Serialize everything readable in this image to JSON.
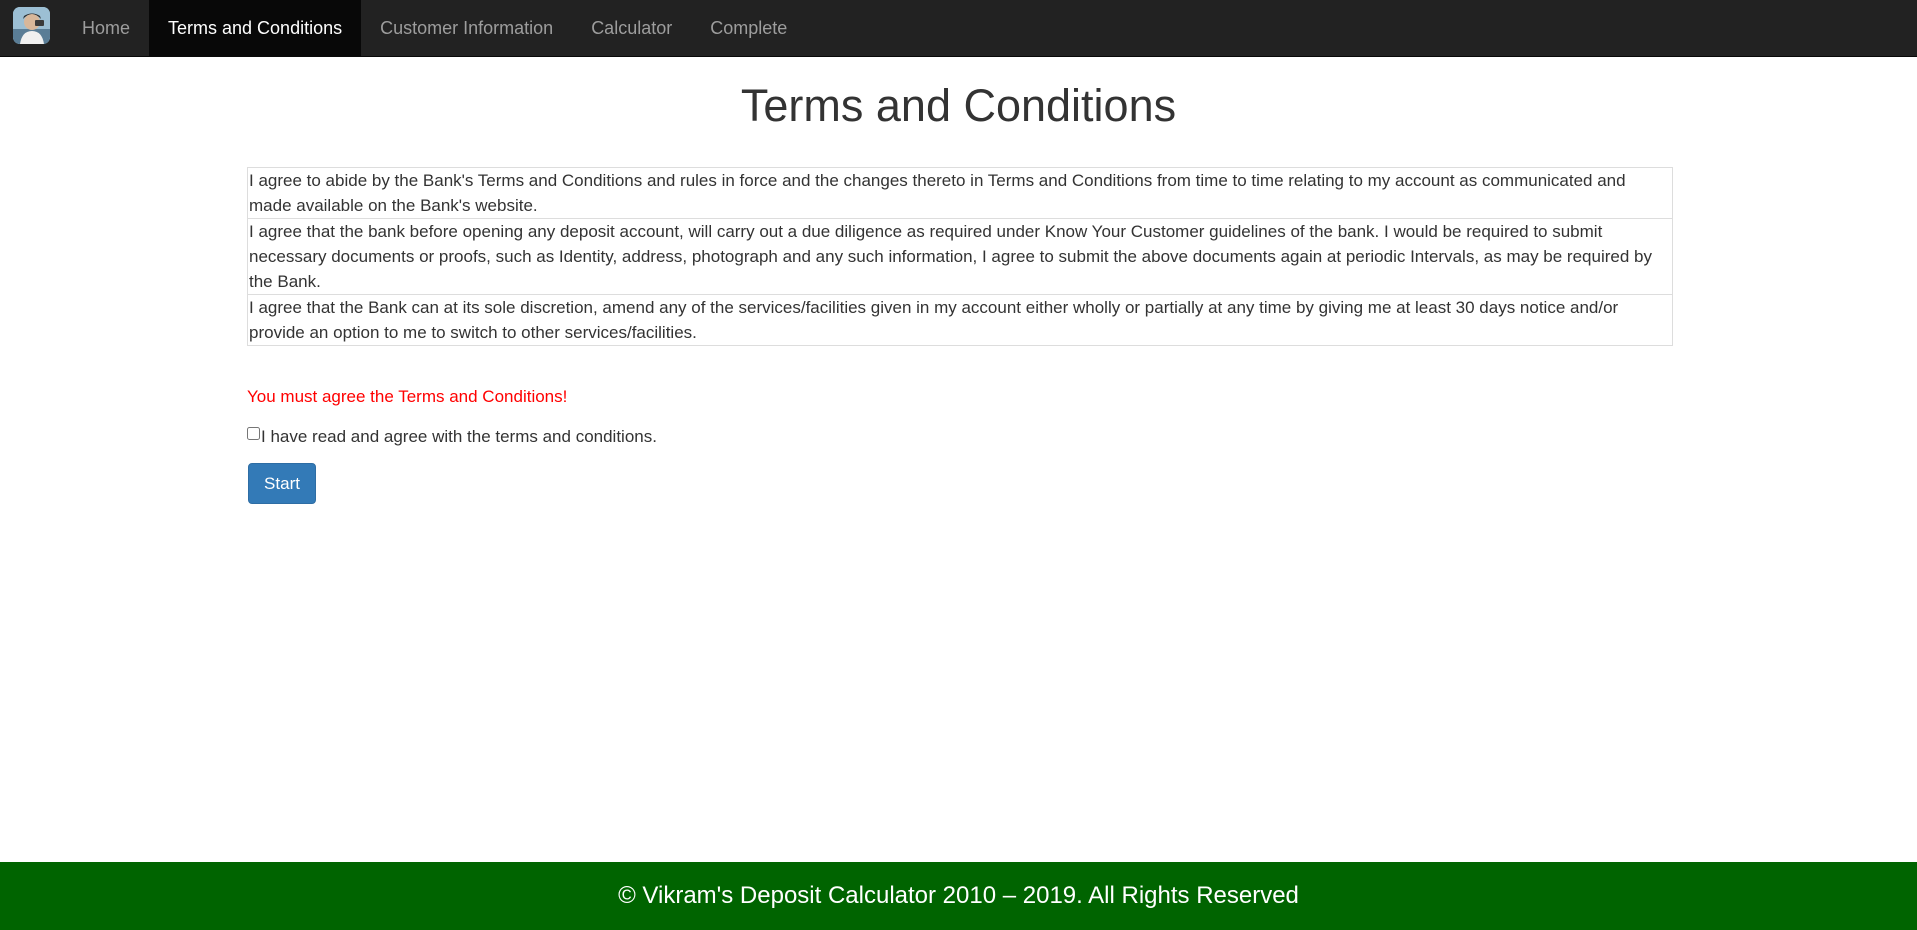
{
  "navbar": {
    "brand_icon": "avatar-logo-icon",
    "items": [
      {
        "label": "Home",
        "active": false
      },
      {
        "label": "Terms and Conditions",
        "active": true
      },
      {
        "label": "Customer Information",
        "active": false
      },
      {
        "label": "Calculator",
        "active": false
      },
      {
        "label": "Complete",
        "active": false
      }
    ]
  },
  "main": {
    "title": "Terms and Conditions",
    "terms": [
      "I agree to abide by the Bank's Terms and Conditions and rules in force and the changes thereto in Terms and Conditions from time to time relating to my account as communicated and made available on the Bank's website.",
      "I agree that the bank before opening any deposit account, will carry out a due diligence as required under Know Your Customer guidelines of the bank. I would be required to submit necessary documents or proofs, such as Identity, address, photograph and any such information, I agree to submit the above documents again at periodic Intervals, as may be required by the Bank.",
      "I agree that the Bank can at its sole discretion, amend any of the services/facilities given in my account either wholly or partially at any time by giving me at least 30 days notice and/or provide an option to me to switch to other services/facilities."
    ],
    "error_message": "You must agree the Terms and Conditions!",
    "agree_label": "I have read and agree with the terms and conditions.",
    "agree_checked": false,
    "start_label": "Start"
  },
  "footer": {
    "text": "© Vikram's Deposit Calculator 2010 – 2019. All Rights Reserved"
  },
  "colors": {
    "navbar_bg": "#222222",
    "nav_active_bg": "#080808",
    "primary_button": "#337ab7",
    "error_text": "#ff0000",
    "footer_bg": "#006400"
  }
}
